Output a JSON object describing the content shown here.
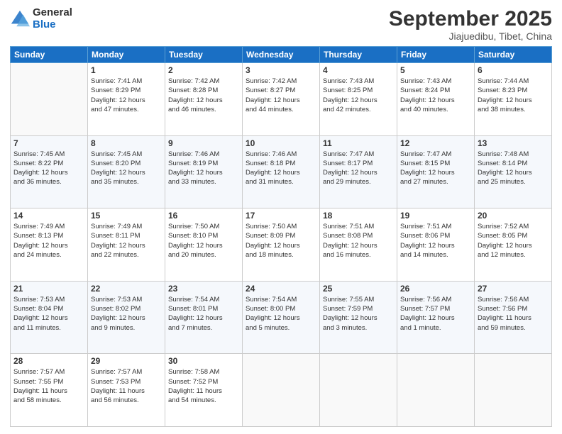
{
  "logo": {
    "general": "General",
    "blue": "Blue"
  },
  "header": {
    "month": "September 2025",
    "location": "Jiajuedibu, Tibet, China"
  },
  "weekdays": [
    "Sunday",
    "Monday",
    "Tuesday",
    "Wednesday",
    "Thursday",
    "Friday",
    "Saturday"
  ],
  "weeks": [
    [
      {
        "day": "",
        "info": ""
      },
      {
        "day": "1",
        "info": "Sunrise: 7:41 AM\nSunset: 8:29 PM\nDaylight: 12 hours\nand 47 minutes."
      },
      {
        "day": "2",
        "info": "Sunrise: 7:42 AM\nSunset: 8:28 PM\nDaylight: 12 hours\nand 46 minutes."
      },
      {
        "day": "3",
        "info": "Sunrise: 7:42 AM\nSunset: 8:27 PM\nDaylight: 12 hours\nand 44 minutes."
      },
      {
        "day": "4",
        "info": "Sunrise: 7:43 AM\nSunset: 8:25 PM\nDaylight: 12 hours\nand 42 minutes."
      },
      {
        "day": "5",
        "info": "Sunrise: 7:43 AM\nSunset: 8:24 PM\nDaylight: 12 hours\nand 40 minutes."
      },
      {
        "day": "6",
        "info": "Sunrise: 7:44 AM\nSunset: 8:23 PM\nDaylight: 12 hours\nand 38 minutes."
      }
    ],
    [
      {
        "day": "7",
        "info": "Sunrise: 7:45 AM\nSunset: 8:22 PM\nDaylight: 12 hours\nand 36 minutes."
      },
      {
        "day": "8",
        "info": "Sunrise: 7:45 AM\nSunset: 8:20 PM\nDaylight: 12 hours\nand 35 minutes."
      },
      {
        "day": "9",
        "info": "Sunrise: 7:46 AM\nSunset: 8:19 PM\nDaylight: 12 hours\nand 33 minutes."
      },
      {
        "day": "10",
        "info": "Sunrise: 7:46 AM\nSunset: 8:18 PM\nDaylight: 12 hours\nand 31 minutes."
      },
      {
        "day": "11",
        "info": "Sunrise: 7:47 AM\nSunset: 8:17 PM\nDaylight: 12 hours\nand 29 minutes."
      },
      {
        "day": "12",
        "info": "Sunrise: 7:47 AM\nSunset: 8:15 PM\nDaylight: 12 hours\nand 27 minutes."
      },
      {
        "day": "13",
        "info": "Sunrise: 7:48 AM\nSunset: 8:14 PM\nDaylight: 12 hours\nand 25 minutes."
      }
    ],
    [
      {
        "day": "14",
        "info": "Sunrise: 7:49 AM\nSunset: 8:13 PM\nDaylight: 12 hours\nand 24 minutes."
      },
      {
        "day": "15",
        "info": "Sunrise: 7:49 AM\nSunset: 8:11 PM\nDaylight: 12 hours\nand 22 minutes."
      },
      {
        "day": "16",
        "info": "Sunrise: 7:50 AM\nSunset: 8:10 PM\nDaylight: 12 hours\nand 20 minutes."
      },
      {
        "day": "17",
        "info": "Sunrise: 7:50 AM\nSunset: 8:09 PM\nDaylight: 12 hours\nand 18 minutes."
      },
      {
        "day": "18",
        "info": "Sunrise: 7:51 AM\nSunset: 8:08 PM\nDaylight: 12 hours\nand 16 minutes."
      },
      {
        "day": "19",
        "info": "Sunrise: 7:51 AM\nSunset: 8:06 PM\nDaylight: 12 hours\nand 14 minutes."
      },
      {
        "day": "20",
        "info": "Sunrise: 7:52 AM\nSunset: 8:05 PM\nDaylight: 12 hours\nand 12 minutes."
      }
    ],
    [
      {
        "day": "21",
        "info": "Sunrise: 7:53 AM\nSunset: 8:04 PM\nDaylight: 12 hours\nand 11 minutes."
      },
      {
        "day": "22",
        "info": "Sunrise: 7:53 AM\nSunset: 8:02 PM\nDaylight: 12 hours\nand 9 minutes."
      },
      {
        "day": "23",
        "info": "Sunrise: 7:54 AM\nSunset: 8:01 PM\nDaylight: 12 hours\nand 7 minutes."
      },
      {
        "day": "24",
        "info": "Sunrise: 7:54 AM\nSunset: 8:00 PM\nDaylight: 12 hours\nand 5 minutes."
      },
      {
        "day": "25",
        "info": "Sunrise: 7:55 AM\nSunset: 7:59 PM\nDaylight: 12 hours\nand 3 minutes."
      },
      {
        "day": "26",
        "info": "Sunrise: 7:56 AM\nSunset: 7:57 PM\nDaylight: 12 hours\nand 1 minute."
      },
      {
        "day": "27",
        "info": "Sunrise: 7:56 AM\nSunset: 7:56 PM\nDaylight: 11 hours\nand 59 minutes."
      }
    ],
    [
      {
        "day": "28",
        "info": "Sunrise: 7:57 AM\nSunset: 7:55 PM\nDaylight: 11 hours\nand 58 minutes."
      },
      {
        "day": "29",
        "info": "Sunrise: 7:57 AM\nSunset: 7:53 PM\nDaylight: 11 hours\nand 56 minutes."
      },
      {
        "day": "30",
        "info": "Sunrise: 7:58 AM\nSunset: 7:52 PM\nDaylight: 11 hours\nand 54 minutes."
      },
      {
        "day": "",
        "info": ""
      },
      {
        "day": "",
        "info": ""
      },
      {
        "day": "",
        "info": ""
      },
      {
        "day": "",
        "info": ""
      }
    ]
  ]
}
